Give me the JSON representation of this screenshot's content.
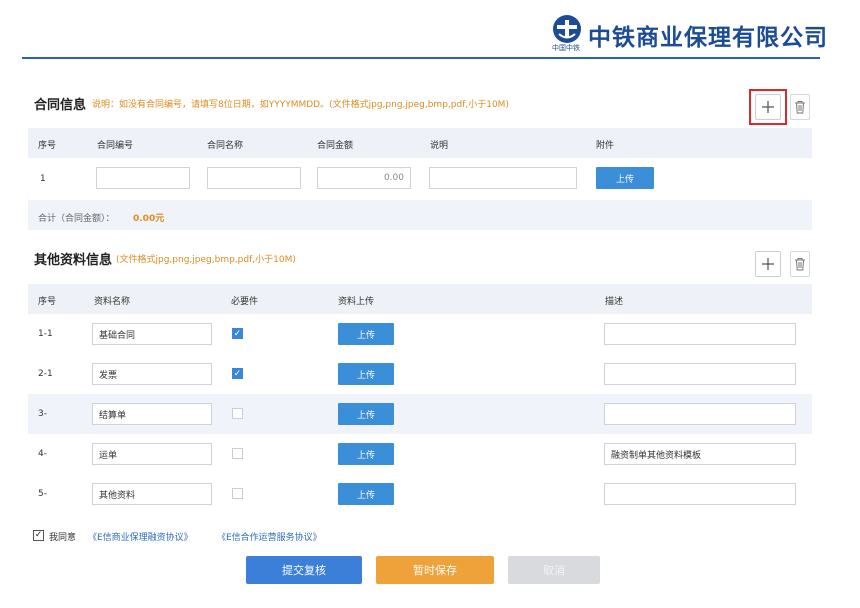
{
  "header": {
    "company_name": "中铁商业保理有限公司",
    "logo_sub": "中国中铁"
  },
  "contract": {
    "title": "合同信息",
    "note": "说明：如没有合同编号，请填写8位日期，如YYYYMMDD。(文件格式jpg,png,jpeg,bmp,pdf,小于10M)",
    "columns": [
      "序号",
      "合同编号",
      "合同名称",
      "合同金额",
      "说明",
      "附件"
    ],
    "row": {
      "index": "1",
      "contract_no": "",
      "contract_name": "",
      "amount": "0.00",
      "desc": "",
      "upload_label": "上传"
    },
    "total_label": "合计（合同金额）：",
    "total_value": "0.00元"
  },
  "other": {
    "title": "其他资料信息",
    "note": "(文件格式jpg,png,jpeg,bmp,pdf,小于10M)",
    "columns": [
      "序号",
      "资料名称",
      "必要件",
      "资料上传",
      "描述"
    ],
    "rows": [
      {
        "index": "1-1",
        "name": "基础合同",
        "required": true,
        "upload_label": "上传",
        "desc": ""
      },
      {
        "index": "2-1",
        "name": "发票",
        "required": true,
        "upload_label": "上传",
        "desc": ""
      },
      {
        "index": "3-",
        "name": "结算单",
        "required": false,
        "upload_label": "上传",
        "desc": ""
      },
      {
        "index": "4-",
        "name": "运单",
        "required": false,
        "upload_label": "上传",
        "desc": "融资制单其他资料模板"
      },
      {
        "index": "5-",
        "name": "其他资料",
        "required": false,
        "upload_label": "上传",
        "desc": ""
      }
    ]
  },
  "footer": {
    "agree_label": "我同意",
    "agreement_1": "《E信商业保理融资协议》",
    "agreement_2": "《E信合作运营服务协议》",
    "submit": "提交复核",
    "save_draft": "暂时保存",
    "cancel": "取消"
  },
  "colors": {
    "brand": "#1c4c95",
    "note": "#e08a1e",
    "upload": "#3b8ed8",
    "submit": "#3b7fd8",
    "save": "#f0a23a",
    "cancel": "#d8dadd",
    "highlight": "#d92a2a"
  }
}
